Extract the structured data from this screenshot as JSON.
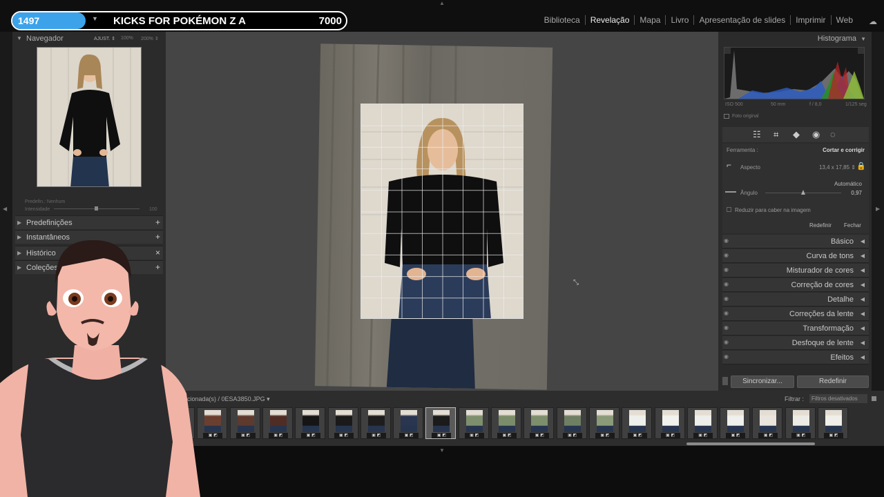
{
  "overlay": {
    "count": "1497",
    "title": "KICKS FOR POKÉMON Z A",
    "goal": "7000"
  },
  "modules": [
    "Biblioteca",
    "Revelação",
    "Mapa",
    "Livro",
    "Apresentação de slides",
    "Imprimir",
    "Web"
  ],
  "active_module": "Revelação",
  "navigator": {
    "title": "Navegador",
    "fit": "AJUST. ⇕",
    "z100": "100%",
    "z200": "200% ⇕"
  },
  "preset_ctrl": {
    "label": "Predefin.: Nenhum",
    "amount_label": "Intensidade",
    "amount_value": "100"
  },
  "left_sections": [
    {
      "label": "Predefinições",
      "btn": "+"
    },
    {
      "label": "Instantâneos",
      "btn": "+"
    },
    {
      "label": "Histórico",
      "btn": "×"
    },
    {
      "label": "Coleções",
      "btn": "+"
    }
  ],
  "histogram": {
    "title": "Histograma",
    "iso": "ISO 500",
    "focal": "50 mm",
    "aperture": "f / 8,0",
    "shutter": "1/125 seg",
    "original": "Foto original"
  },
  "crop": {
    "tool_label": "Ferramenta :",
    "tool_value": "Cortar e corrigir",
    "aspect_label": "Aspecto",
    "aspect_value": "13,4 x 17,85 ⇕",
    "auto": "Automático",
    "angle_label": "Ângulo",
    "angle_value": "0,97",
    "constrain": "Reduzir para caber na imagem",
    "reset": "Redefinir",
    "close": "Fechar"
  },
  "right_sections": [
    "Básico",
    "Curva de tons",
    "Misturador de cores",
    "Correção de cores",
    "Detalhe",
    "Correções da lente",
    "Transformação",
    "Desfoque de lente",
    "Efeitos"
  ],
  "sync_button": "Sincronizar...",
  "reset_button": "Redefinir",
  "filmstrip": {
    "info": "/ 177 selecionada(s) / 0ESA3850.JPG ▾",
    "filter_label": "Filtrar :",
    "filter_value": "Filtros desativados",
    "thumbs": [
      "#5a3a2e",
      "#6b3f30",
      "#5e3a2d",
      "#4f2c24",
      "#151515",
      "#1a1a1a",
      "#1d1d1d",
      "#2a3550",
      "#1b1b1b",
      "#7e8f6e",
      "#7b8c6a",
      "#7d8e6c",
      "#6f7f64",
      "#8b9a78",
      "#efefeb",
      "#f1f1ee",
      "#eeeeea",
      "#f0f0ec",
      "#e9e4dc",
      "#ecebe6",
      "#f0efe9"
    ]
  },
  "colors": {
    "accent": "#3ca3ea",
    "panel": "#2b2b2b",
    "center": "#454545"
  }
}
